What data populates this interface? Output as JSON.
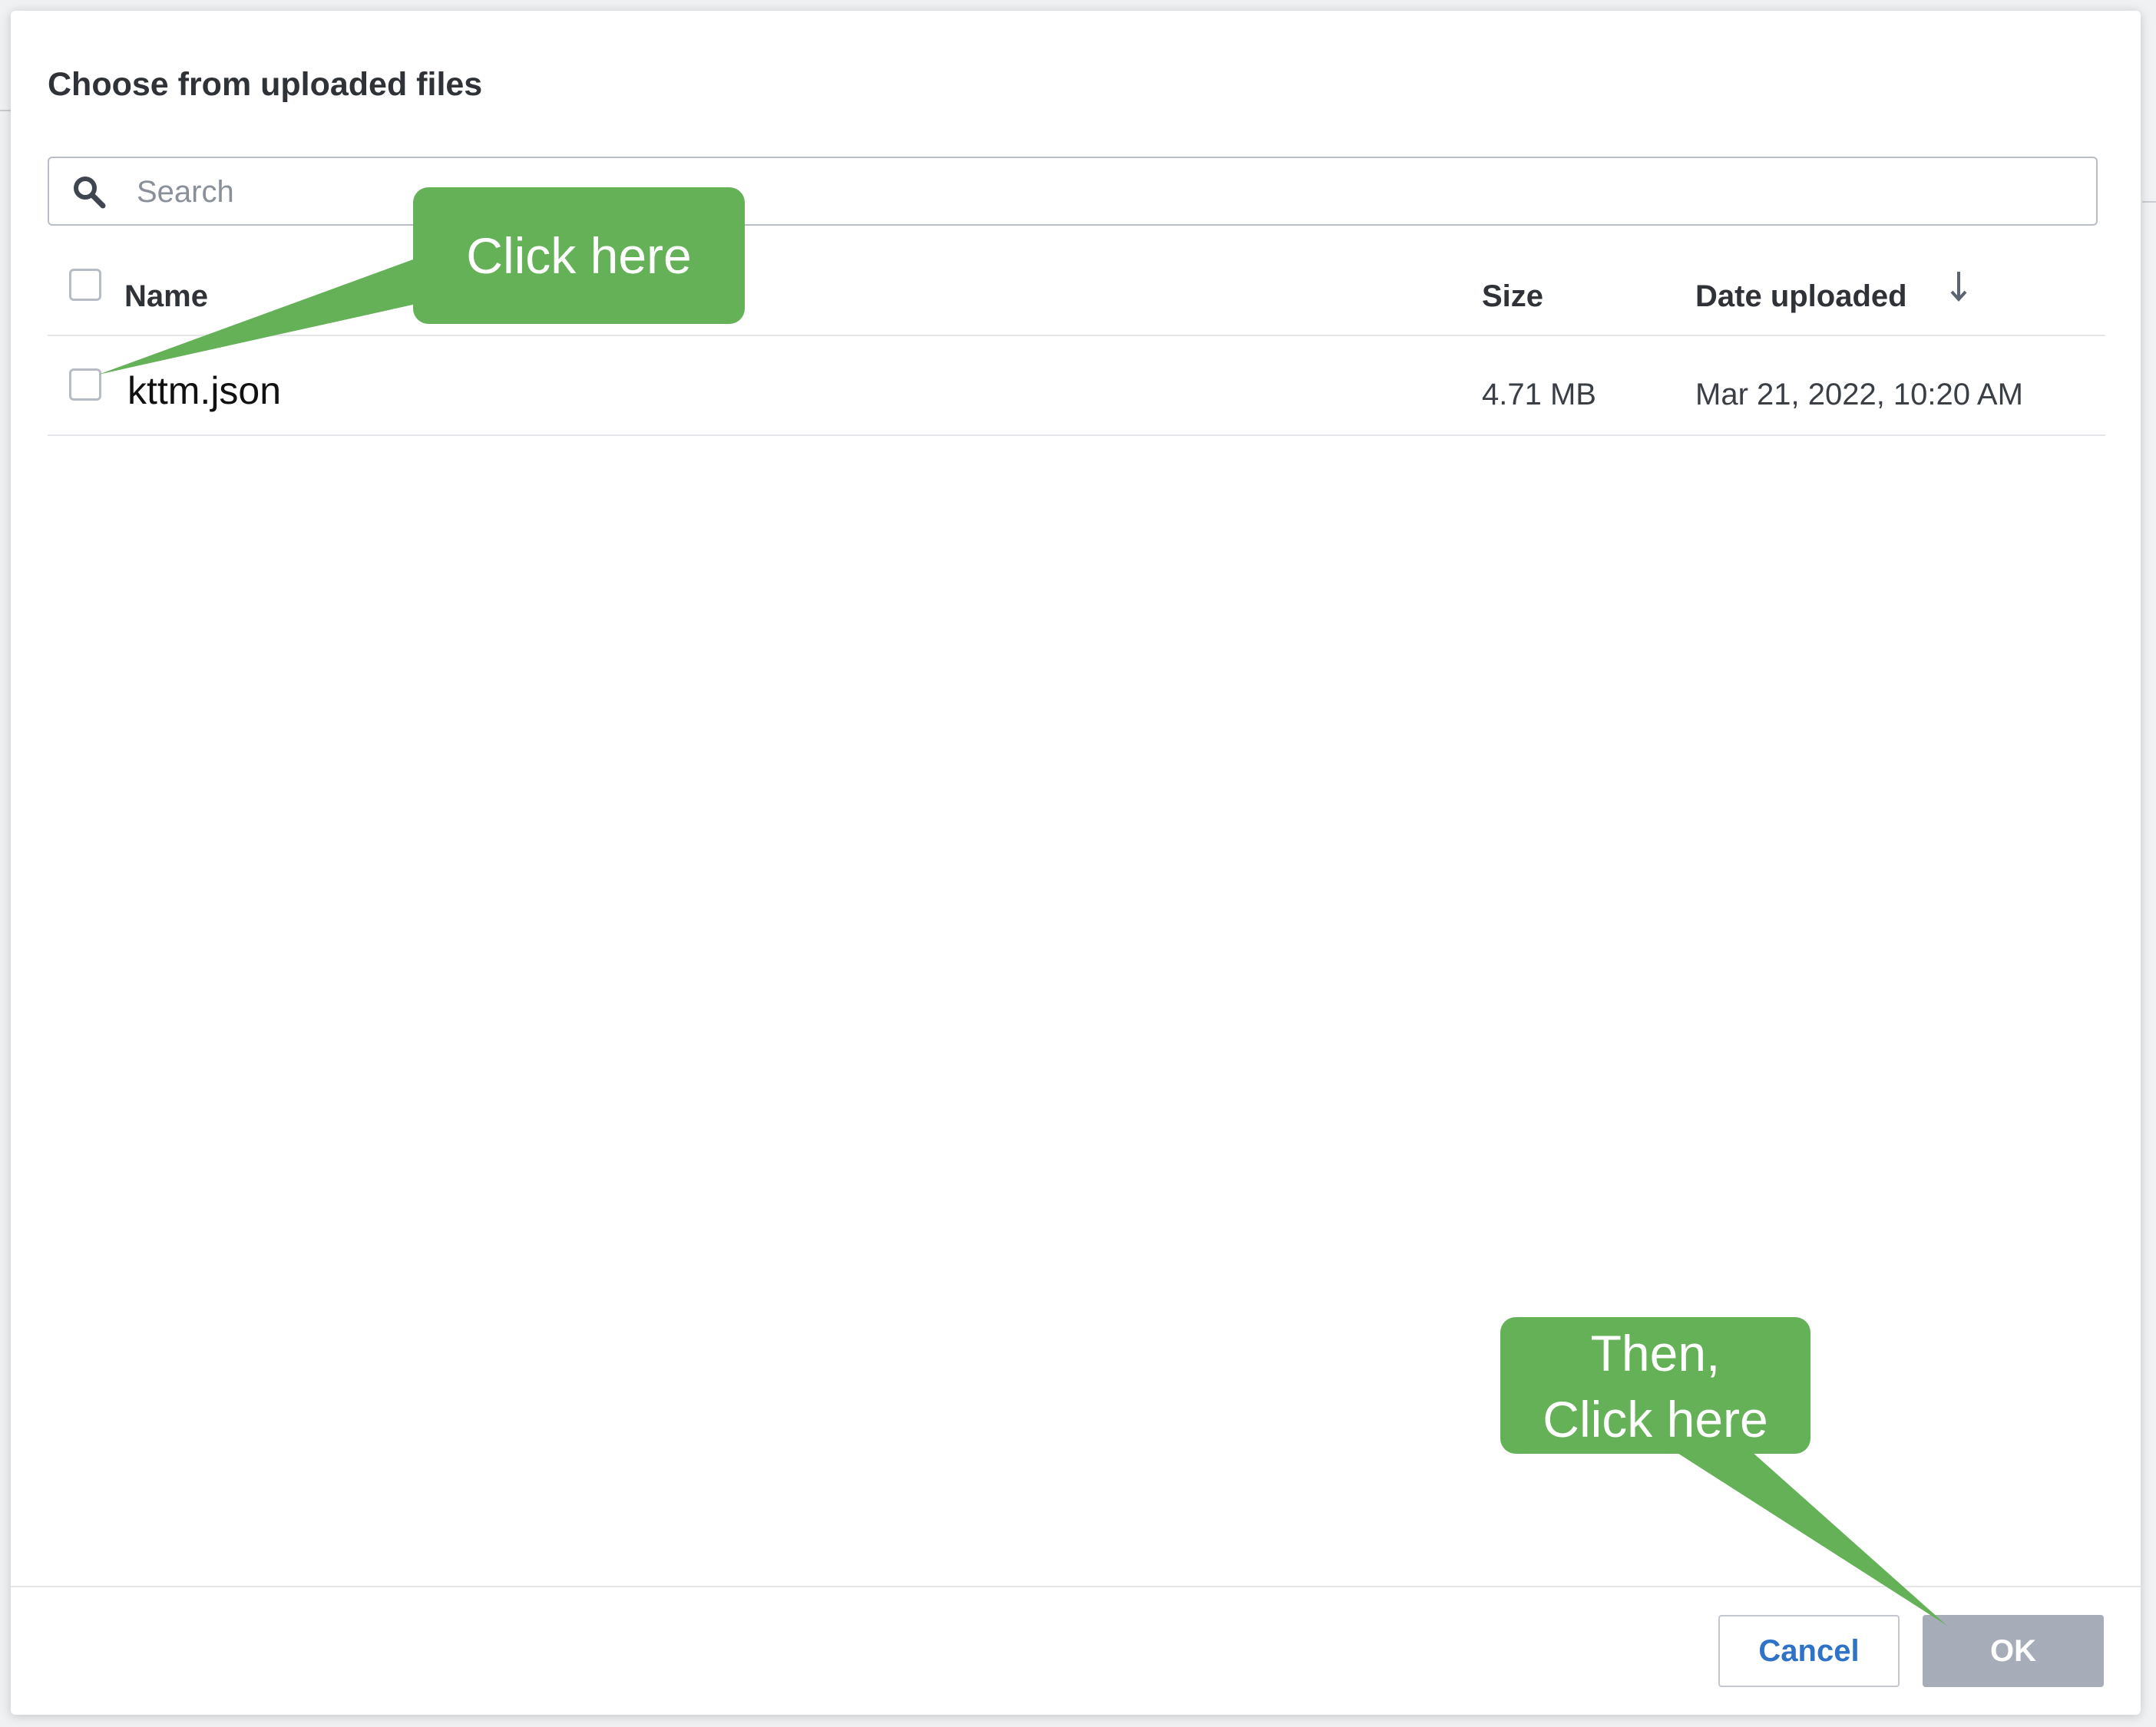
{
  "dialog": {
    "title": "Choose from uploaded files",
    "search": {
      "placeholder": "Search",
      "value": ""
    },
    "table": {
      "columns": {
        "name": "Name",
        "size": "Size",
        "date": "Date uploaded"
      },
      "sort": {
        "column": "Date uploaded",
        "direction": "descending",
        "icon": "arrow-down-icon"
      },
      "rows": [
        {
          "name": "kttm.json",
          "size": "4.71 MB",
          "date": "Mar 21, 2022, 10:20 AM",
          "checked": false
        }
      ]
    },
    "footer": {
      "cancel_label": "Cancel",
      "ok_label": "OK"
    }
  },
  "annotations": {
    "callout_1": "Click here",
    "callout_2_line1": "Then,",
    "callout_2_line2": "Click here",
    "color": "#65b158"
  },
  "colors": {
    "ok_disabled": "#a7adb8",
    "cancel_text": "#2f73c7"
  }
}
